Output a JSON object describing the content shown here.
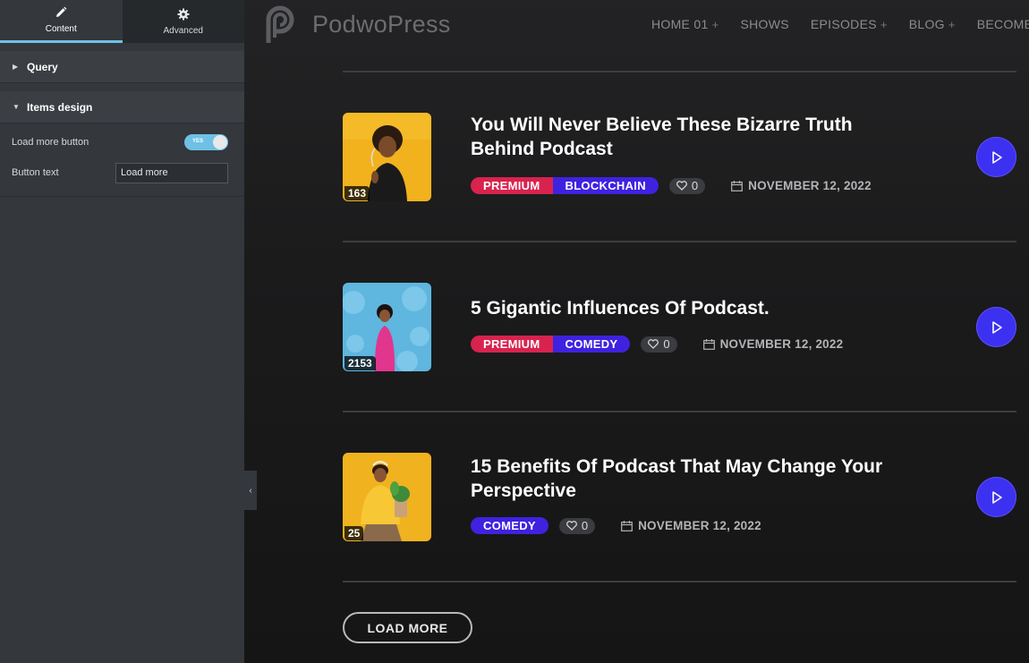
{
  "panel": {
    "tabs": [
      {
        "label": "Content",
        "icon": "pencil-icon",
        "active": true
      },
      {
        "label": "Advanced",
        "icon": "gear-icon",
        "active": false
      }
    ],
    "sections": {
      "query": {
        "label": "Query",
        "expanded": false
      },
      "items_design": {
        "label": "Items design",
        "expanded": true
      }
    },
    "controls": {
      "load_more_label": "Load more button",
      "load_more_toggle": "YES",
      "button_text_label": "Button text",
      "button_text_value": "Load more"
    },
    "accent": "#6ec1e4"
  },
  "site": {
    "logo_text": "PodwoPress",
    "nav": [
      {
        "label": "HOME 01",
        "has_sub": true,
        "plus": "+"
      },
      {
        "label": "SHOWS",
        "has_sub": false,
        "plus": ""
      },
      {
        "label": "EPISODES",
        "has_sub": true,
        "plus": "+"
      },
      {
        "label": "BLOG",
        "has_sub": true,
        "plus": "+"
      },
      {
        "label": "BECOME AN AU",
        "has_sub": false,
        "plus": ""
      }
    ],
    "episodes": [
      {
        "title": "You Will Never Believe These Bizarre Truth Behind Podcast",
        "count": "163",
        "tags": [
          "PREMIUM",
          "BLOCKCHAIN"
        ],
        "likes": "0",
        "date": "NOVEMBER 12, 2022"
      },
      {
        "title": "5 Gigantic Influences Of Podcast.",
        "count": "2153",
        "tags": [
          "PREMIUM",
          "COMEDY"
        ],
        "likes": "0",
        "date": "NOVEMBER 12, 2022"
      },
      {
        "title": "15 Benefits Of Podcast That May Change Your Perspective",
        "count": "25",
        "tags": [
          "COMEDY"
        ],
        "likes": "0",
        "date": "NOVEMBER 12, 2022"
      }
    ],
    "load_more_label": "LOAD MORE",
    "colors": {
      "premium": "#d8234e",
      "category": "#3f22e0",
      "play": "#3c31f0"
    }
  }
}
